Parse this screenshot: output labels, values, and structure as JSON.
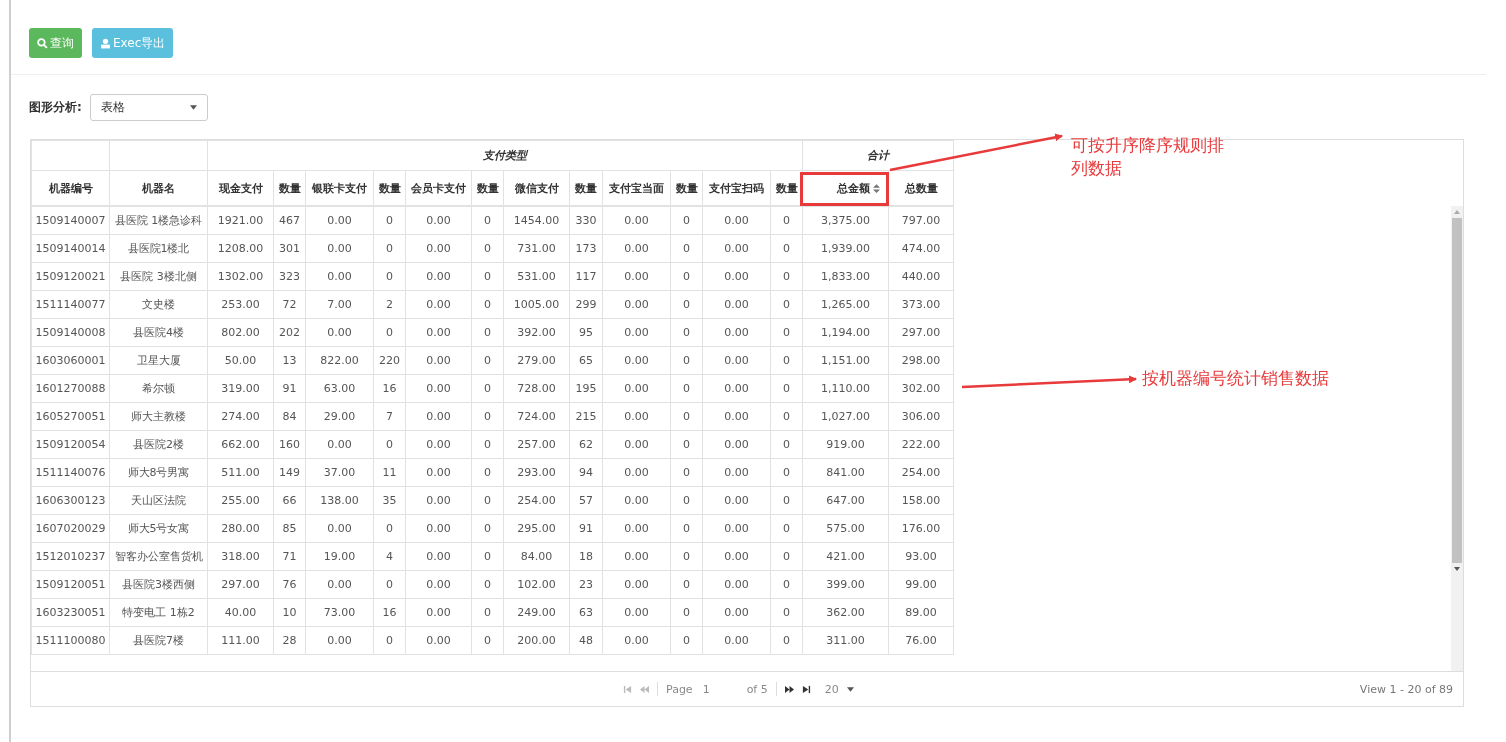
{
  "toolbar": {
    "buttons": [
      {
        "label": "查询",
        "kind": "search"
      },
      {
        "label": "Exec导出",
        "kind": "export"
      }
    ]
  },
  "chart_mode": {
    "label": "图形分析:",
    "value": "表格"
  },
  "table": {
    "group_headers": [
      "支付类型",
      "合计"
    ],
    "columns": [
      {
        "label": "机器编号",
        "kind": "plain"
      },
      {
        "label": "机器名",
        "kind": "plain"
      },
      {
        "label": "现金支付",
        "kind": "plain"
      },
      {
        "label": "数量",
        "kind": "plain"
      },
      {
        "label": "银联卡支付",
        "kind": "plain"
      },
      {
        "label": "数量",
        "kind": "plain"
      },
      {
        "label": "会员卡支付",
        "kind": "plain"
      },
      {
        "label": "数量",
        "kind": "plain"
      },
      {
        "label": "微信支付",
        "kind": "plain"
      },
      {
        "label": "数量",
        "kind": "plain"
      },
      {
        "label": "支付宝当面",
        "kind": "plain"
      },
      {
        "label": "数量",
        "kind": "plain"
      },
      {
        "label": "支付宝扫码",
        "kind": "plain"
      },
      {
        "label": "数量",
        "kind": "plain"
      },
      {
        "label": "总金额",
        "kind": "sort_marked"
      },
      {
        "label": "总数量",
        "kind": "plain"
      }
    ],
    "rows": [
      [
        "1509140007",
        "县医院 1楼急诊科",
        "1921.00",
        "467",
        "0.00",
        "0",
        "0.00",
        "0",
        "1454.00",
        "330",
        "0.00",
        "0",
        "0.00",
        "0",
        "3,375.00",
        "797.00"
      ],
      [
        "1509140014",
        "县医院1楼北",
        "1208.00",
        "301",
        "0.00",
        "0",
        "0.00",
        "0",
        "731.00",
        "173",
        "0.00",
        "0",
        "0.00",
        "0",
        "1,939.00",
        "474.00"
      ],
      [
        "1509120021",
        "县医院 3楼北侧",
        "1302.00",
        "323",
        "0.00",
        "0",
        "0.00",
        "0",
        "531.00",
        "117",
        "0.00",
        "0",
        "0.00",
        "0",
        "1,833.00",
        "440.00"
      ],
      [
        "1511140077",
        "文史楼",
        "253.00",
        "72",
        "7.00",
        "2",
        "0.00",
        "0",
        "1005.00",
        "299",
        "0.00",
        "0",
        "0.00",
        "0",
        "1,265.00",
        "373.00"
      ],
      [
        "1509140008",
        "县医院4楼",
        "802.00",
        "202",
        "0.00",
        "0",
        "0.00",
        "0",
        "392.00",
        "95",
        "0.00",
        "0",
        "0.00",
        "0",
        "1,194.00",
        "297.00"
      ],
      [
        "1603060001",
        "卫星大厦",
        "50.00",
        "13",
        "822.00",
        "220",
        "0.00",
        "0",
        "279.00",
        "65",
        "0.00",
        "0",
        "0.00",
        "0",
        "1,151.00",
        "298.00"
      ],
      [
        "1601270088",
        "希尔顿",
        "319.00",
        "91",
        "63.00",
        "16",
        "0.00",
        "0",
        "728.00",
        "195",
        "0.00",
        "0",
        "0.00",
        "0",
        "1,110.00",
        "302.00"
      ],
      [
        "1605270051",
        "师大主教楼",
        "274.00",
        "84",
        "29.00",
        "7",
        "0.00",
        "0",
        "724.00",
        "215",
        "0.00",
        "0",
        "0.00",
        "0",
        "1,027.00",
        "306.00"
      ],
      [
        "1509120054",
        "县医院2楼",
        "662.00",
        "160",
        "0.00",
        "0",
        "0.00",
        "0",
        "257.00",
        "62",
        "0.00",
        "0",
        "0.00",
        "0",
        "919.00",
        "222.00"
      ],
      [
        "1511140076",
        "师大8号男寓",
        "511.00",
        "149",
        "37.00",
        "11",
        "0.00",
        "0",
        "293.00",
        "94",
        "0.00",
        "0",
        "0.00",
        "0",
        "841.00",
        "254.00"
      ],
      [
        "1606300123",
        "天山区法院",
        "255.00",
        "66",
        "138.00",
        "35",
        "0.00",
        "0",
        "254.00",
        "57",
        "0.00",
        "0",
        "0.00",
        "0",
        "647.00",
        "158.00"
      ],
      [
        "1607020029",
        "师大5号女寓",
        "280.00",
        "85",
        "0.00",
        "0",
        "0.00",
        "0",
        "295.00",
        "91",
        "0.00",
        "0",
        "0.00",
        "0",
        "575.00",
        "176.00"
      ],
      [
        "1512010237",
        "智客办公室售货机",
        "318.00",
        "71",
        "19.00",
        "4",
        "0.00",
        "0",
        "84.00",
        "18",
        "0.00",
        "0",
        "0.00",
        "0",
        "421.00",
        "93.00"
      ],
      [
        "1509120051",
        "县医院3楼西侧",
        "297.00",
        "76",
        "0.00",
        "0",
        "0.00",
        "0",
        "102.00",
        "23",
        "0.00",
        "0",
        "0.00",
        "0",
        "399.00",
        "99.00"
      ],
      [
        "1603230051",
        "特变电工 1栋2",
        "40.00",
        "10",
        "73.00",
        "16",
        "0.00",
        "0",
        "249.00",
        "63",
        "0.00",
        "0",
        "0.00",
        "0",
        "362.00",
        "89.00"
      ],
      [
        "1511100080",
        "县医院7楼",
        "111.00",
        "28",
        "0.00",
        "0",
        "0.00",
        "0",
        "200.00",
        "48",
        "0.00",
        "0",
        "0.00",
        "0",
        "311.00",
        "76.00"
      ]
    ]
  },
  "pager": {
    "page_label": "Page",
    "page": "1",
    "of": "of 5",
    "page_size": "20",
    "view": "View 1 - 20 of 89"
  },
  "annotations": [
    {
      "text": "可按升序降序规则排列数据"
    },
    {
      "text": "按机器编号统计销售数据"
    }
  ]
}
